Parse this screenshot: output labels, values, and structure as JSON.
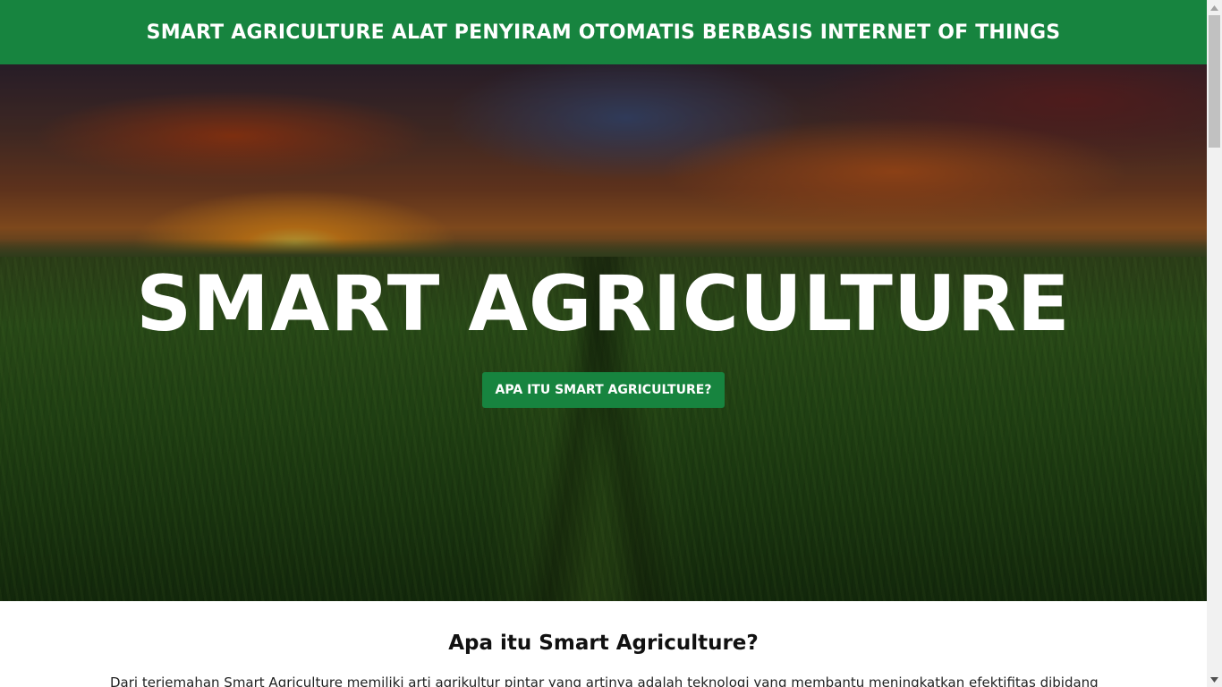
{
  "header": {
    "title": "SMART AGRICULTURE ALAT PENYIRAM OTOMATIS BERBASIS INTERNET OF THINGS"
  },
  "hero": {
    "heading": "SMART AGRICULTURE",
    "button_label": "APA ITU SMART AGRICULTURE?"
  },
  "about": {
    "title": "Apa itu Smart Agriculture?",
    "text": "Dari terjemahan Smart Agriculture memiliki arti agrikultur pintar yang artinya adalah teknologi yang membantu meningkatkan efektifitas dibidang pertanian"
  },
  "colors": {
    "brand": "#17843f"
  },
  "scrollbar": {
    "up_icon": "triangle-up-icon",
    "down_icon": "triangle-down-icon"
  }
}
